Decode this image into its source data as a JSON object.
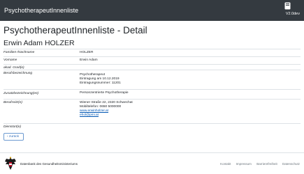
{
  "navbar": {
    "brand": "PsychotherapeutInnenliste",
    "version": "V2.0dev"
  },
  "page": {
    "title": "PsychotherapeutInnenliste - Detail",
    "person_name": "Erwin Adam HOLZER"
  },
  "details": {
    "familienname": {
      "label": "Familien-/Nachname",
      "value": "HOLZER"
    },
    "vorname": {
      "label": "Vorname",
      "value": "Erwin Adam"
    },
    "akad_grade": {
      "label": "akad. Grad(e)",
      "value": ""
    },
    "berufsbezeichnung": {
      "label": "Berufsbezeichnung",
      "line1": "Psychotherapeut",
      "line2": "Eintragung am 10.12.2019",
      "line3": "Eintragungsnummer: 11201"
    },
    "zusatzbezeichnungen": {
      "label": "Zusatzbezeichnung(en)",
      "value": "Personzentrierte Psychotherapie"
    },
    "berufssitz": {
      "label": "Berufssitz(e)",
      "address": "Wiener Straße 22, 2320 Schwechat",
      "phone": "Mobiltelefon: 0650 5000000",
      "website": "www.erwinholzer.at",
      "email": "ehol@pmi.at"
    },
    "dienstort": {
      "label": "Dienstort(e)",
      "value": ""
    }
  },
  "back_button": {
    "label": "‹ zurück"
  },
  "footer": {
    "text": "Datenbank des Gesundheitsministeriums",
    "links": [
      "Kontakt",
      "Impressum",
      "Barrierefreiheit",
      "Datenschutz"
    ]
  }
}
